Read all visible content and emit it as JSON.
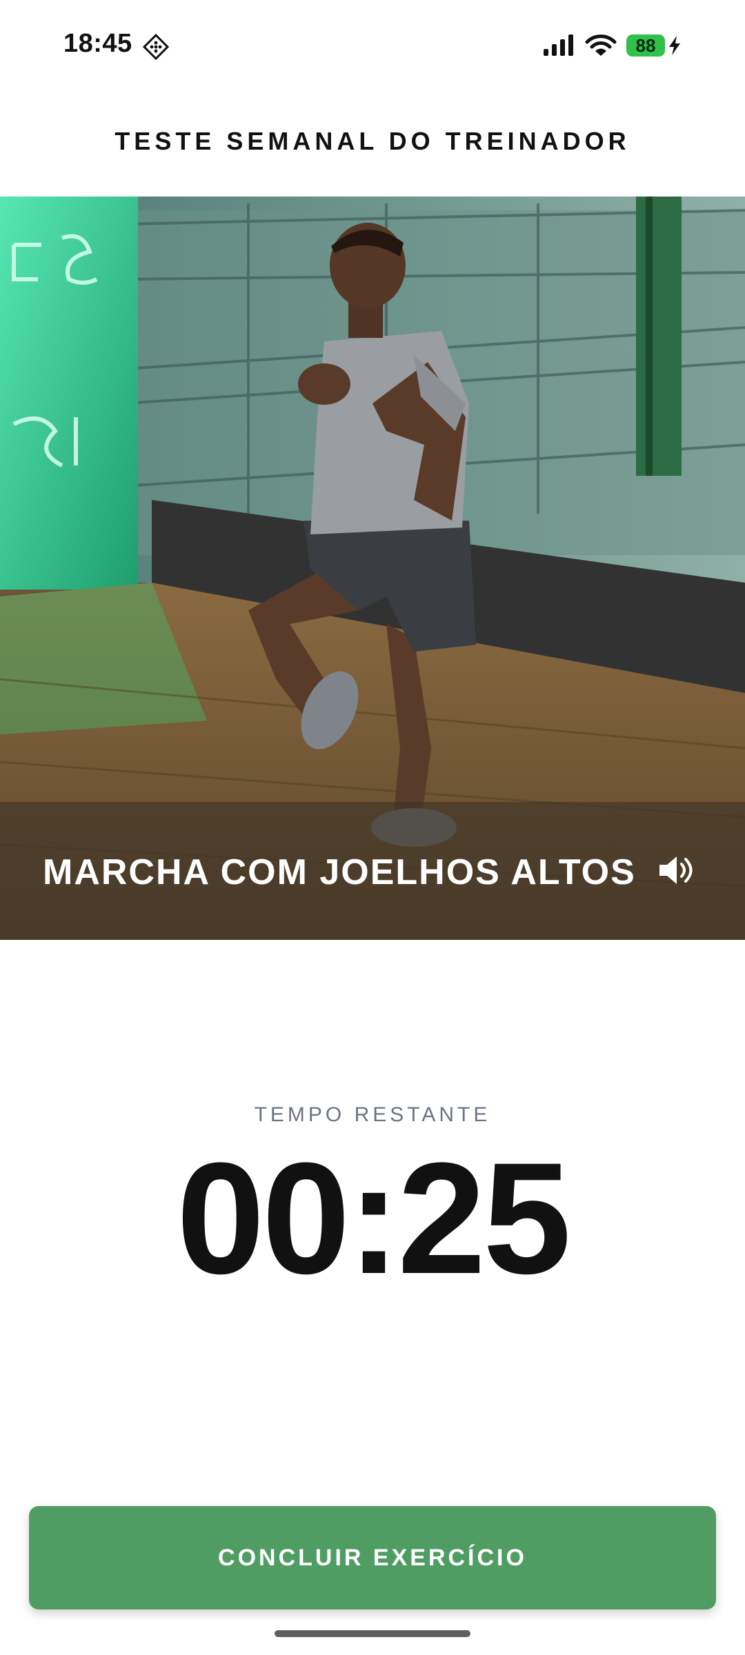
{
  "status_bar": {
    "time": "18:45",
    "battery_level": "88",
    "icons": [
      "focus-icon",
      "signal-icon",
      "wifi-icon",
      "battery-icon",
      "charging-bolt-icon"
    ],
    "battery_color": "#2fc14a"
  },
  "header": {
    "title": "TESTE SEMANAL DO TREINADOR"
  },
  "video": {
    "exercise_name": "MARCHA COM JOELHOS ALTOS",
    "sound_icon": "speaker-icon"
  },
  "timer": {
    "label": "TEMPO RESTANTE",
    "value": "00:25"
  },
  "actions": {
    "finish_label": "CONCLUIR EXERCÍCIO",
    "finish_color": "#4f9d63"
  }
}
